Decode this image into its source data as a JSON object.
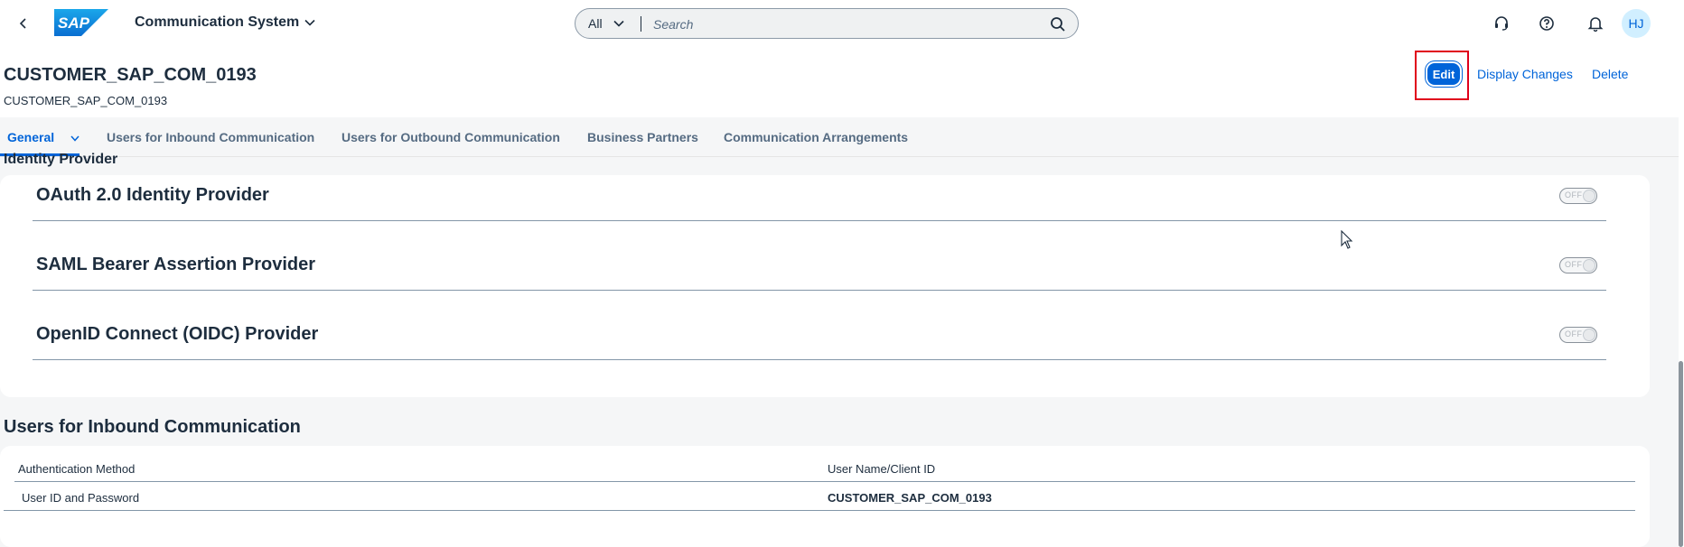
{
  "shell": {
    "back_icon": "chevron-left-icon",
    "logo_text": "SAP",
    "app_title": "Communication System",
    "search": {
      "scope": "All",
      "placeholder": "Search",
      "icon": "search-icon"
    },
    "icons": [
      "headset-icon",
      "help-icon",
      "bell-icon"
    ],
    "avatar_initials": "HJ"
  },
  "header": {
    "title": "CUSTOMER_SAP_COM_0193",
    "subtitle": "CUSTOMER_SAP_COM_0193",
    "actions": {
      "edit": "Edit",
      "display_changes": "Display Changes",
      "delete": "Delete"
    }
  },
  "tabs": [
    {
      "label": "General",
      "active": true
    },
    {
      "label": "Users for Inbound Communication",
      "active": false
    },
    {
      "label": "Users for Outbound Communication",
      "active": false
    },
    {
      "label": "Business Partners",
      "active": false
    },
    {
      "label": "Communication Arrangements",
      "active": false
    }
  ],
  "identity_section": {
    "heading": "Identity Provider",
    "providers": [
      {
        "title": "OAuth 2.0 Identity Provider",
        "switch_label": "OFF"
      },
      {
        "title": "SAML Bearer Assertion Provider",
        "switch_label": "OFF"
      },
      {
        "title": "OpenID Connect (OIDC) Provider",
        "switch_label": "OFF"
      }
    ]
  },
  "inbound_section": {
    "heading": "Users for Inbound Communication",
    "columns": [
      "Authentication Method",
      "User Name/Client ID"
    ],
    "rows": [
      [
        "User ID and Password",
        "CUSTOMER_SAP_COM_0193"
      ]
    ]
  },
  "colors": {
    "brand": "#0064d9",
    "highlight": "#e0001b",
    "text": "#1d2d3e",
    "background": "#f5f6f7"
  }
}
